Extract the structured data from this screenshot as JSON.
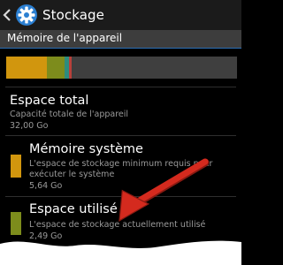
{
  "appbar": {
    "title": "Stockage",
    "back_icon": "chevron-left-icon",
    "app_icon": "gear-icon"
  },
  "section": {
    "title": "Mémoire de l'appareil"
  },
  "colors": {
    "system": "#d1960e",
    "used": "#7d8c1c",
    "teal": "#2e8c7e",
    "red": "#b8403a",
    "free": "#3f3f3f",
    "accent": "#2a6fb6",
    "arrow": "#d42a1e"
  },
  "usage_bar": {
    "segments": [
      {
        "name": "system",
        "fraction": 0.176,
        "color": "#d1960e"
      },
      {
        "name": "used",
        "fraction": 0.078,
        "color": "#7d8c1c"
      },
      {
        "name": "teal",
        "fraction": 0.019,
        "color": "#2e8c7e"
      },
      {
        "name": "red",
        "fraction": 0.012,
        "color": "#b8403a"
      }
    ]
  },
  "items": {
    "total": {
      "title": "Espace total",
      "subtitle": "Capacité totale de l'appareil",
      "value": "32,00 Go"
    },
    "system": {
      "title": "Mémoire système",
      "subtitle_1": "L'espace de stockage minimum requis pour",
      "subtitle_2": "exécuter le système",
      "value": "5,64 Go"
    },
    "used": {
      "title": "Espace utilisé",
      "subtitle": "L'espace de stockage actuellement utilisé",
      "value": "2,49 Go"
    }
  }
}
